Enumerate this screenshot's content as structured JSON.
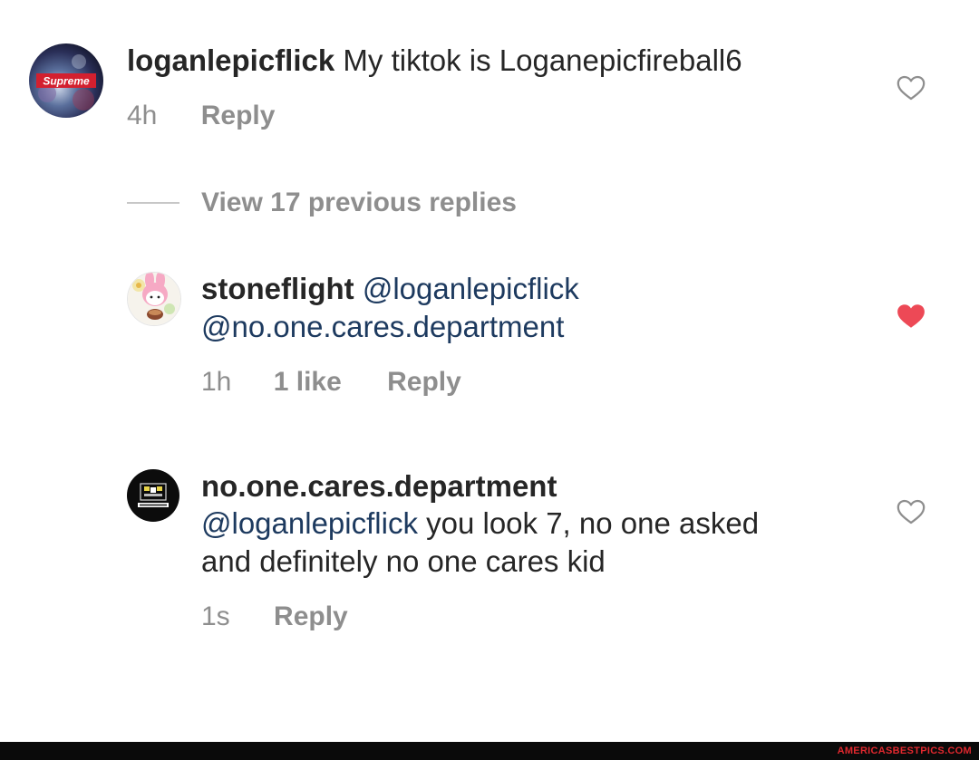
{
  "comments": [
    {
      "username": "loganlepicflick",
      "text": "My tiktok is Loganepicfireball6",
      "time": "4h",
      "reply": "Reply",
      "liked": false,
      "avatar_label": "Supreme"
    },
    {
      "username": "stoneflight",
      "mention1": "@loganlepicflick",
      "mention2": "@no.one.cares.department",
      "time": "1h",
      "likes": "1 like",
      "reply": "Reply",
      "liked": true
    },
    {
      "username": "no.one.cares.department",
      "mention": "@loganlepicflick",
      "text_line1": "you look 7, no one asked",
      "text_line2": "and definitely no one cares kid",
      "time": "1s",
      "reply": "Reply",
      "liked": false
    }
  ],
  "view_replies": "View 17 previous replies",
  "watermark": "AMERICASBESTPICS.COM",
  "colors": {
    "text": "#262626",
    "muted": "#8e8e8e",
    "mention": "#1d3a5f",
    "heart_liked": "#ed4956",
    "heart_outline": "#8e8e8e"
  }
}
